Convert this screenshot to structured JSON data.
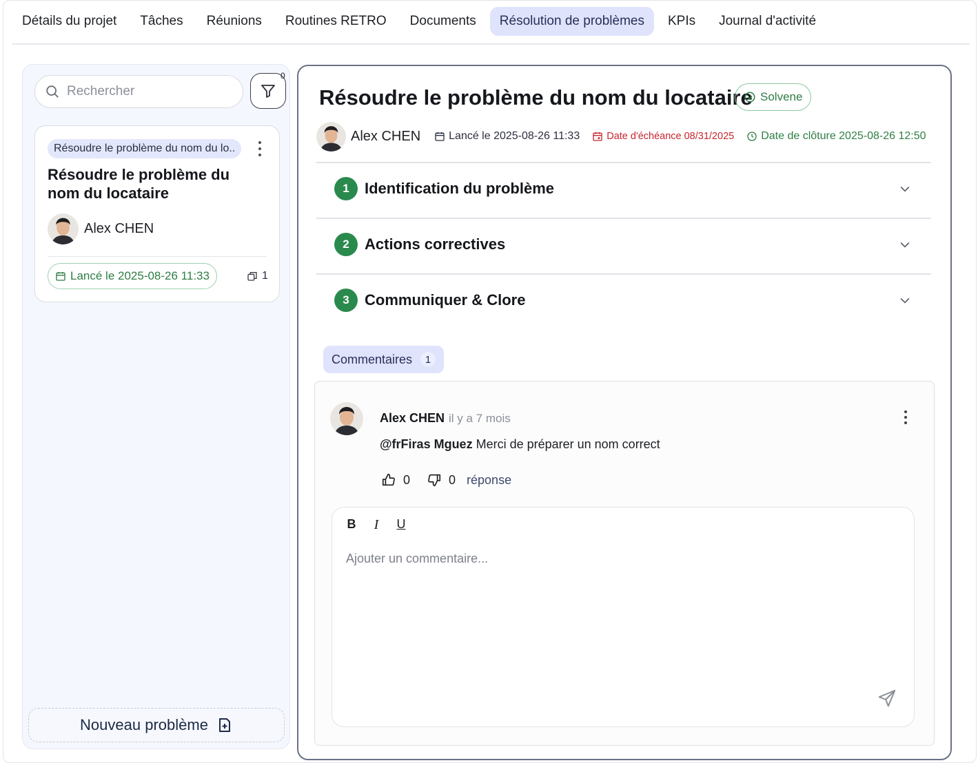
{
  "tabs": [
    {
      "label": "Détails du projet",
      "active": false
    },
    {
      "label": "Tâches",
      "active": false
    },
    {
      "label": "Réunions",
      "active": false
    },
    {
      "label": "Routines RETRO",
      "active": false
    },
    {
      "label": "Documents",
      "active": false
    },
    {
      "label": "Résolution de problèmes",
      "active": true
    },
    {
      "label": "KPIs",
      "active": false
    },
    {
      "label": "Journal d'activité",
      "active": false
    }
  ],
  "sidebar": {
    "search_placeholder": "Rechercher",
    "filter_count": "0",
    "card": {
      "chip": "Résoudre le problème du nom du lo..",
      "title": "Résoudre le problème du nom du locataire",
      "user": "Alex CHEN",
      "date": "Lancé le 2025-08-26 11:33",
      "count": "1"
    },
    "new_button": "Nouveau problème"
  },
  "detail": {
    "title": "Résoudre le problème du nom du locataire",
    "status": "Solvene",
    "user": "Alex CHEN",
    "started": "Lancé le 2025-08-26 11:33",
    "due": "Date d'échéance 08/31/2025",
    "closed": "Date de clôture 2025-08-26 12:50",
    "sections": [
      {
        "num": "1",
        "label": "Identification du problème"
      },
      {
        "num": "2",
        "label": "Actions correctives"
      },
      {
        "num": "3",
        "label": "Communiquer & Clore"
      }
    ],
    "comments_tab": {
      "label": "Commentaires",
      "count": "1"
    },
    "comment": {
      "author": "Alex CHEN",
      "time": "il y a 7 mois",
      "mention": "@frFiras Mguez",
      "text": " Merci de préparer un nom correct",
      "likes": "0",
      "dislikes": "0",
      "reply": "réponse"
    },
    "editor": {
      "bold": "B",
      "italic": "I",
      "underline": "U",
      "placeholder": "Ajouter un commentaire..."
    }
  },
  "colors": {
    "accent_tab": "#dfe3fb",
    "success": "#2e7d44",
    "danger": "#c6262e",
    "step": "#2a8a4d"
  }
}
